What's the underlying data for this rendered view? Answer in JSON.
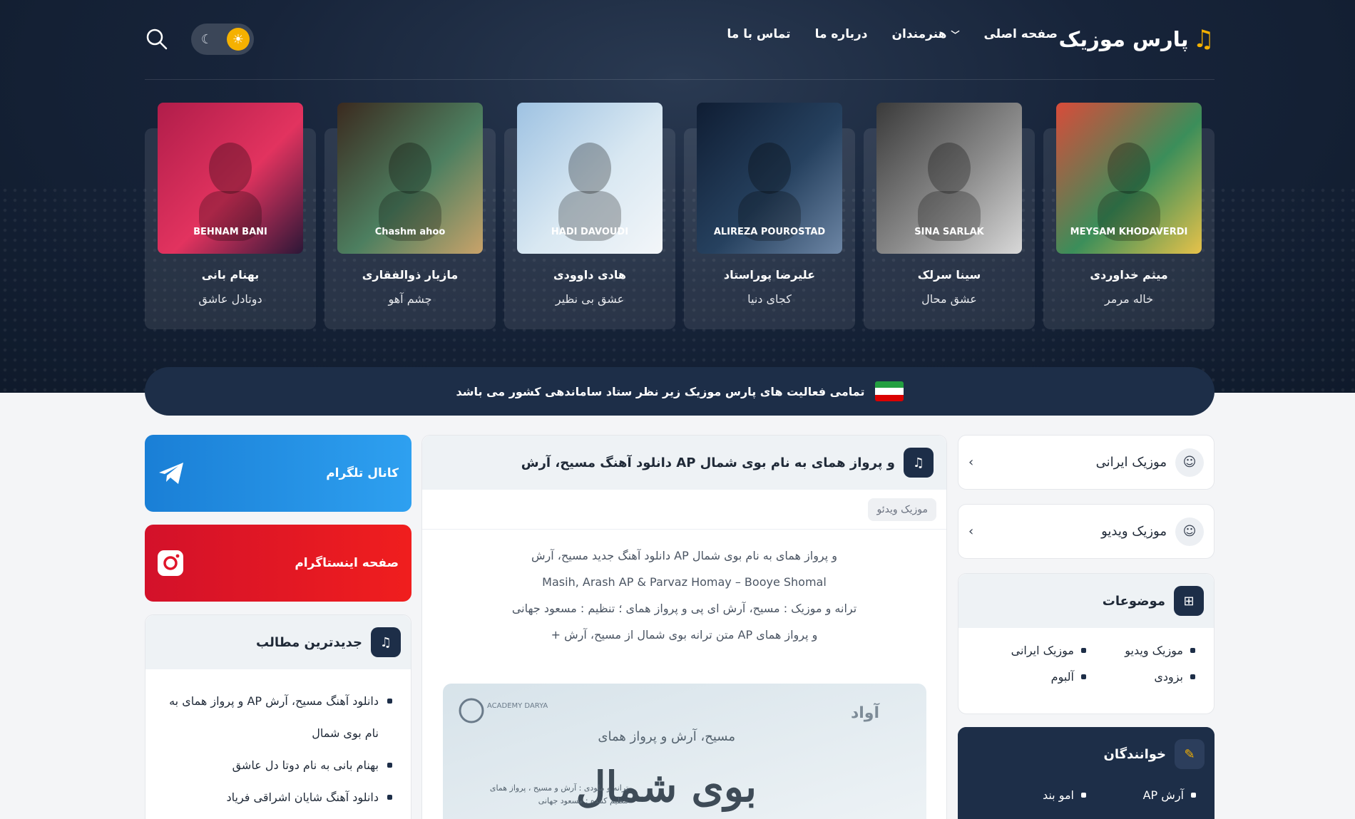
{
  "header": {
    "logo_text": "پارس موزیک",
    "nav": [
      {
        "label": "صفحه اصلی",
        "has_dropdown": false
      },
      {
        "label": "هنرمندان",
        "has_dropdown": true
      },
      {
        "label": "درباره ما",
        "has_dropdown": false
      },
      {
        "label": "تماس با ما",
        "has_dropdown": false
      }
    ]
  },
  "slider": [
    {
      "artist": "میثم خداوردی",
      "song": "خاله مرمر",
      "cover_text": "MEYSAM KHODAVERDI",
      "cover_colors": [
        "#d94b3a",
        "#3b8e5a",
        "#e7c24a"
      ]
    },
    {
      "artist": "سینا سرلک",
      "song": "عشق محال",
      "cover_text": "SINA SARLAK",
      "cover_colors": [
        "#3a3a3a",
        "#8a8a8a",
        "#d8d8d8"
      ]
    },
    {
      "artist": "علیرضا پوراستاد",
      "song": "کجای دنیا",
      "cover_text": "ALIREZA POUROSTAD",
      "cover_colors": [
        "#0f1d33",
        "#26415f",
        "#6d86a5"
      ]
    },
    {
      "artist": "هادی داوودی",
      "song": "عشق بی نظیر",
      "cover_text": "HADI DAVOUDI",
      "cover_colors": [
        "#9ec2e2",
        "#d9e8f2",
        "#f3f6f9"
      ]
    },
    {
      "artist": "مازیار ذوالفقاری",
      "song": "چشم آهو",
      "cover_text": "Chashm ahoo",
      "cover_colors": [
        "#3b2a1f",
        "#4d7f60",
        "#c9a36a"
      ]
    },
    {
      "artist": "بهنام بانی",
      "song": "دوتادل عاشق",
      "cover_text": "BEHNAM BANI",
      "cover_colors": [
        "#b01d4a",
        "#e2335f",
        "#2b1737"
      ]
    }
  ],
  "notice": "تمامی فعالیت های پارس موزیک زیر نظر ستاد ساماندهی کشور می باشد",
  "categories": [
    {
      "label": "موزیک ایرانی"
    },
    {
      "label": "موزیک ویدیو"
    }
  ],
  "topics": {
    "title": "موضوعات",
    "items": [
      "موزیک ویدیو",
      "موزیک ایرانی",
      "بزودی",
      "آلبوم"
    ]
  },
  "singers": {
    "title": "خوانندگان",
    "items": [
      "آرش AP",
      "امو بند"
    ]
  },
  "post": {
    "title": "دانلود آهنگ مسیح، آرش AP و پرواز همای به نام بوی شمال",
    "tag": "موزیک ویدئو",
    "lines": [
      "دانلود آهنگ جدید مسیح، آرش AP و پرواز همای به نام بوی شمال",
      "Masih, Arash AP & Parvaz Homay – Booye Shomal",
      "ترانه و موزیک : مسیح، آرش ای پی و پرواز همای ؛ تنظیم : مسعود جهانی",
      "+ متن ترانه بوی شمال از مسیح، آرش AP و پرواز همای"
    ],
    "cover": {
      "brand_left": "ACADEMY DARYA",
      "brand_right": "آواد",
      "artists": "مسیح، آرش و پرواز همای",
      "title": "بوی شمال",
      "credit1": "ترانه و ملودی : آرش و مسیح ، پرواز همای",
      "credit2": "تنظیم کننده : مسعود جهانی"
    }
  },
  "social": {
    "telegram": "کانال تلگرام",
    "instagram": "صفحه اینستاگرام"
  },
  "latest": {
    "title": "جدیدترین مطالب",
    "items": [
      "دانلود آهنگ مسیح، آرش AP و پرواز همای به نام بوی شمال",
      "بهنام بانی به نام دوتا دل عاشق",
      "دانلود آهنگ شایان اشراقی فریاد"
    ]
  },
  "colors": {
    "accent": "#f5b100",
    "dark": "#1d2e48",
    "telegram": "#1a7fd6",
    "instagram": "#e0152a"
  }
}
